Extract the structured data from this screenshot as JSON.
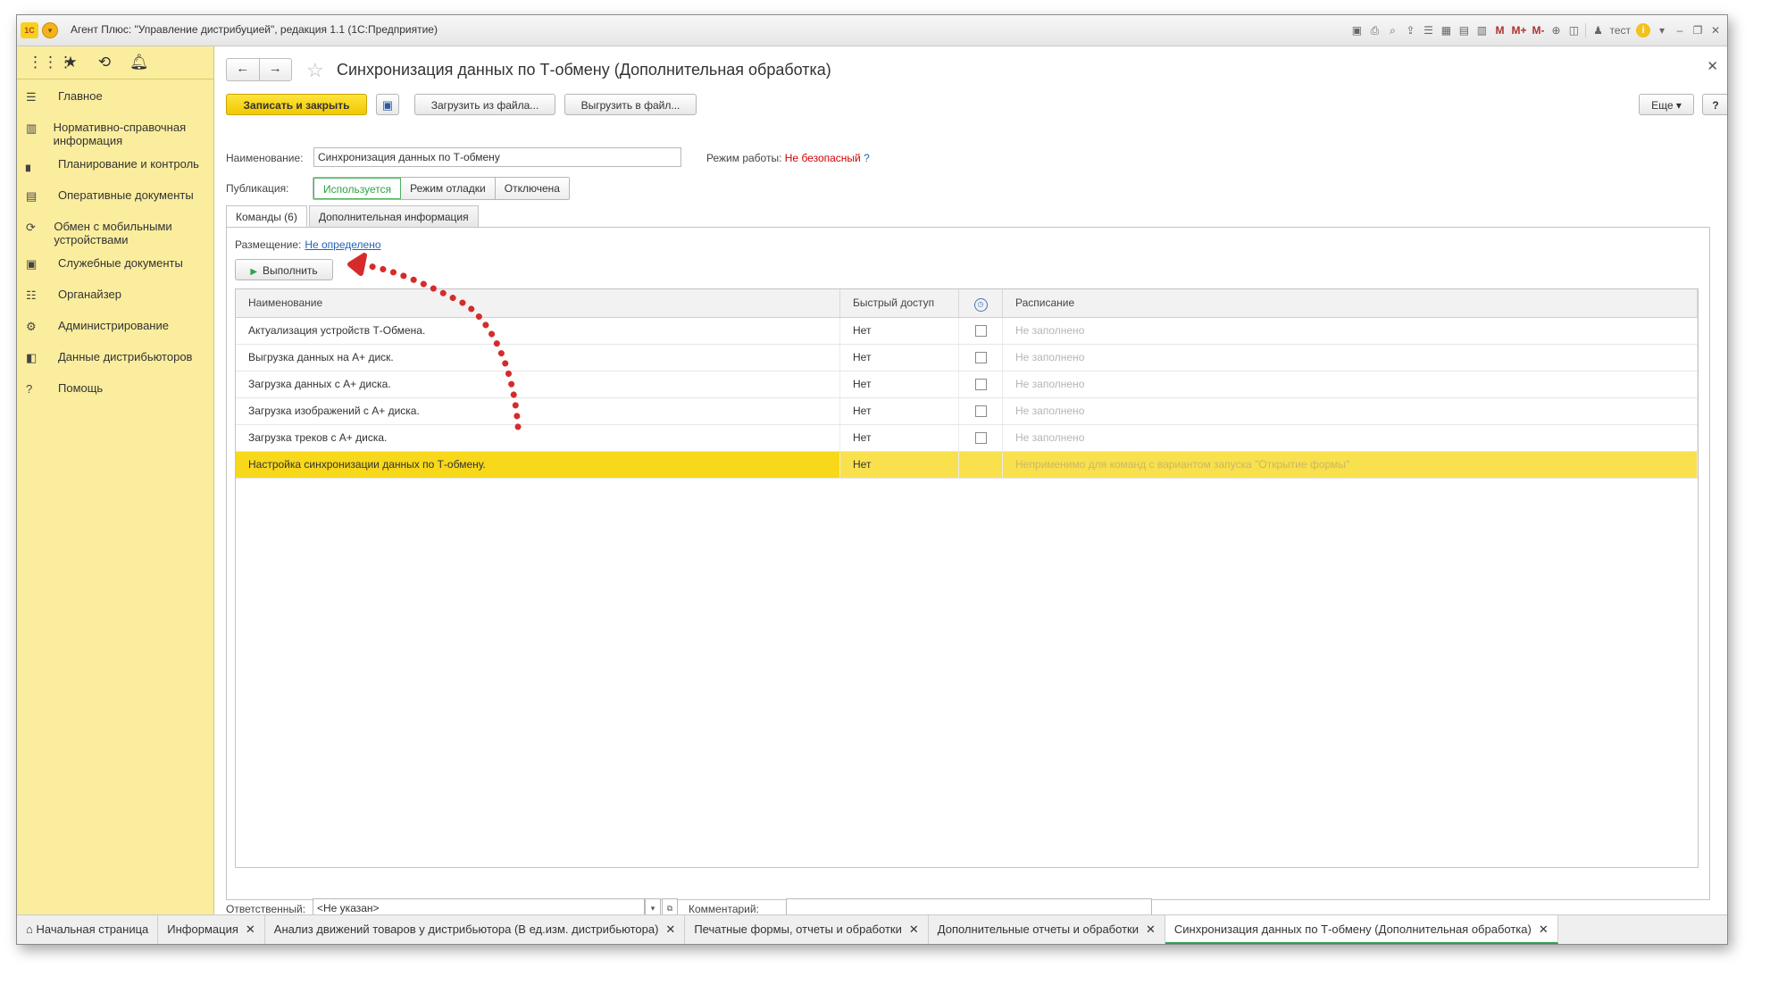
{
  "window": {
    "title": "Агент Плюс: \"Управление дистрибуцией\", редакция 1.1  (1С:Предприятие)",
    "logo_text": "1С",
    "toolbar": {
      "m1": "M",
      "m2": "M+",
      "m3": "M-",
      "user": "тест"
    }
  },
  "sidebar": {
    "items": [
      {
        "label": "Главное",
        "icon": "menu-icon"
      },
      {
        "label": "Нормативно-справочная информация",
        "icon": "reference-icon"
      },
      {
        "label": "Планирование и контроль",
        "icon": "chart-icon"
      },
      {
        "label": "Оперативные документы",
        "icon": "documents-icon"
      },
      {
        "label": "Обмен с мобильными устройствами",
        "icon": "sync-icon"
      },
      {
        "label": "Служебные документы",
        "icon": "service-documents-icon"
      },
      {
        "label": "Органайзер",
        "icon": "organizer-icon"
      },
      {
        "label": "Администрирование",
        "icon": "gear-icon"
      },
      {
        "label": "Данные дистрибьюторов",
        "icon": "distributors-icon"
      },
      {
        "label": "Помощь",
        "icon": "help-icon"
      }
    ]
  },
  "form": {
    "title": "Синхронизация данных по Т-обмену (Дополнительная обработка)",
    "buttons": {
      "save_close": "Записать и закрыть",
      "load_file": "Загрузить из файла...",
      "export_file": "Выгрузить в файл...",
      "more": "Еще",
      "help": "?"
    },
    "name_label": "Наименование:",
    "name_value": "Синхронизация данных по Т-обмену",
    "mode_label": "Режим работы:",
    "mode_value": "Не безопасный",
    "mode_help": "?",
    "publication_label": "Публикация:",
    "publication_options": [
      "Используется",
      "Режим отладки",
      "Отключена"
    ],
    "publication_selected": "Используется",
    "tabs": [
      "Команды (6)",
      "Дополнительная информация"
    ],
    "placement_label": "Размещение:",
    "placement_value": "Не определено",
    "run_button": "Выполнить",
    "table": {
      "columns": [
        "Наименование",
        "Быстрый доступ",
        "",
        "Расписание"
      ],
      "rows": [
        {
          "name": "Актуализация устройств Т-Обмена.",
          "quick": "Нет",
          "check": true,
          "schedule": "Не заполнено"
        },
        {
          "name": "Выгрузка данных на А+ диск.",
          "quick": "Нет",
          "check": true,
          "schedule": "Не заполнено"
        },
        {
          "name": "Загрузка данных с А+ диска.",
          "quick": "Нет",
          "check": true,
          "schedule": "Не заполнено"
        },
        {
          "name": "Загрузка изображений с А+ диска.",
          "quick": "Нет",
          "check": true,
          "schedule": "Не заполнено"
        },
        {
          "name": "Загрузка треков с А+ диска.",
          "quick": "Нет",
          "check": true,
          "schedule": "Не заполнено"
        },
        {
          "name": "Настройка синхронизации данных по Т-обмену.",
          "quick": "Нет",
          "check": false,
          "schedule": "Неприменимо для команд с вариантом запуска \"Открытие формы\""
        }
      ],
      "selected_row": 5
    },
    "responsible_label": "Ответственный:",
    "responsible_value": "<Не указан>",
    "comment_label": "Комментарий:",
    "comment_value": ""
  },
  "taskbar": {
    "items": [
      {
        "label": "Начальная страница",
        "closable": false
      },
      {
        "label": "Информация",
        "closable": true
      },
      {
        "label": "Анализ движений товаров у дистрибьютора (В ед.изм. дистрибьютора)",
        "closable": true
      },
      {
        "label": "Печатные формы, отчеты и обработки",
        "closable": true
      },
      {
        "label": "Дополнительные отчеты и обработки",
        "closable": true
      },
      {
        "label": "Синхронизация данных по Т-обмену (Дополнительная обработка)",
        "closable": true
      }
    ],
    "active": 5
  },
  "colors": {
    "accent_yellow": "#f9e04d",
    "sidebar": "#fbed9e",
    "annotation_arrow": "#d62b2b",
    "status_red": "#d40000"
  }
}
